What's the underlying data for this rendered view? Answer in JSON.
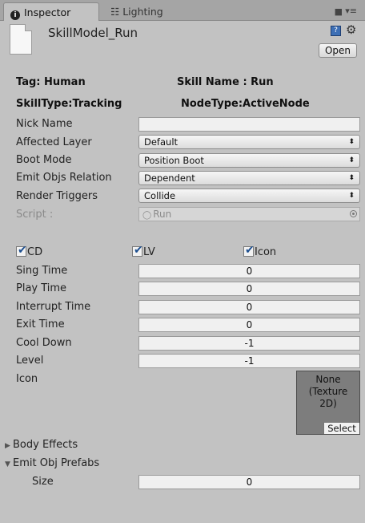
{
  "tabs": [
    {
      "label": "Inspector",
      "icon": "info-icon"
    },
    {
      "label": "Lighting",
      "icon": "lighting-icon"
    }
  ],
  "header": {
    "asset_name": "SkillModel_Run",
    "open_label": "Open"
  },
  "summary": {
    "tag": "Tag: Human",
    "skill_name": "Skill Name : Run",
    "skill_type": "SkillType:Tracking",
    "node_type": "NodeType:ActiveNode"
  },
  "fields": {
    "nick_name": {
      "label": "Nick Name",
      "value": ""
    },
    "affected_layer": {
      "label": "Affected Layer",
      "value": "Default"
    },
    "boot_mode": {
      "label": "Boot Mode",
      "value": "Position Boot"
    },
    "emit_objs_relation": {
      "label": "Emit Objs Relation",
      "value": "Dependent"
    },
    "render_triggers": {
      "label": "Render Triggers",
      "value": "Collide"
    },
    "script": {
      "label": "Script :",
      "value": "Run"
    }
  },
  "toggles": [
    {
      "label": "CD",
      "checked": true
    },
    {
      "label": "LV",
      "checked": true
    },
    {
      "label": "Icon",
      "checked": true
    }
  ],
  "timings": [
    {
      "label": "Sing Time",
      "value": "0"
    },
    {
      "label": "Play Time",
      "value": "0"
    },
    {
      "label": "Interrupt Time",
      "value": "0"
    },
    {
      "label": "Exit Time",
      "value": "0"
    },
    {
      "label": "Cool Down",
      "value": "-1"
    },
    {
      "label": "Level",
      "value": "-1"
    }
  ],
  "icon_field": {
    "label": "Icon",
    "line1": "None",
    "line2": "(Texture",
    "line3": "2D)",
    "select_label": "Select"
  },
  "foldouts": {
    "body_effects": "Body Effects",
    "emit_obj_prefabs": "Emit Obj Prefabs",
    "size_label": "Size",
    "size_value": "0"
  },
  "glyphs": {
    "dropdown_arrows": "⬍",
    "checkmark": "✔",
    "collapsed": "▶",
    "expanded": "▼",
    "info": "i",
    "lighting": "☷",
    "lock": "🔒",
    "menu": "▾≡",
    "gear": "⚙",
    "book": "?"
  },
  "colors": {
    "panel_bg": "#c2c2c2",
    "tabbar_bg": "#a5a5a5",
    "texture_bg": "#7d7d7d",
    "check_color": "#1d4f8f"
  }
}
